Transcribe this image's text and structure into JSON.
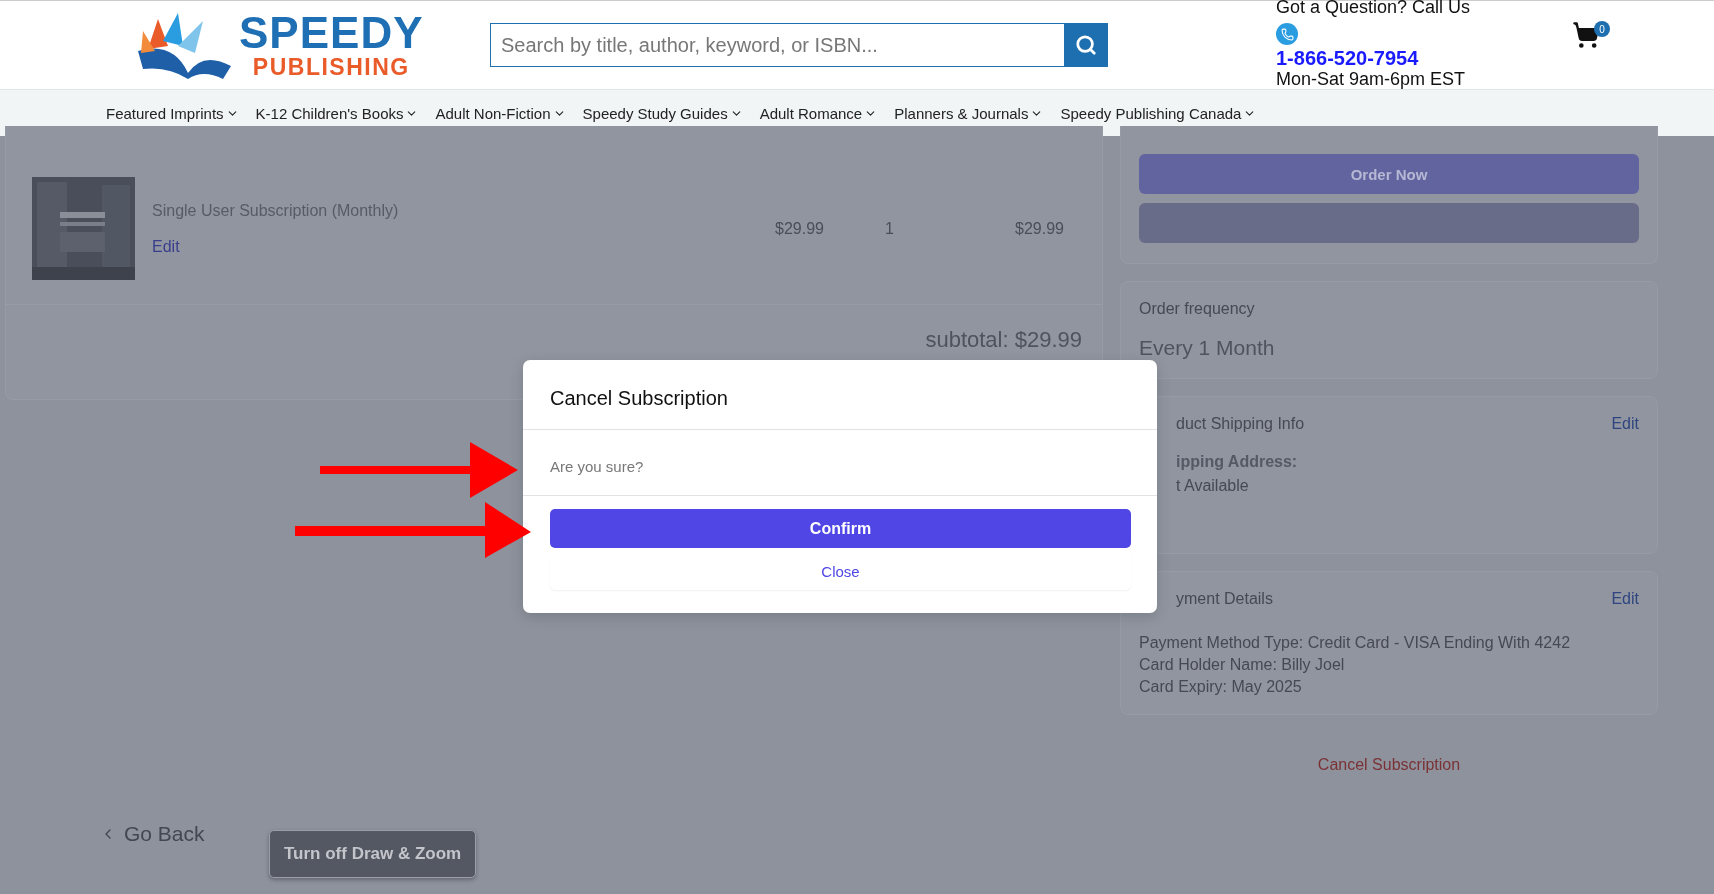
{
  "header": {
    "logo": {
      "line1": "SPEEDY",
      "line2": "PUBLISHING"
    },
    "search": {
      "placeholder": "Search by title, author, keyword, or ISBN..."
    },
    "contact": {
      "question": "Got a Question? Call Us",
      "phone": "1-866-520-7954",
      "hours": "Mon-Sat 9am-6pm EST"
    },
    "cart": {
      "count": "0"
    }
  },
  "nav": [
    "Featured Imprints",
    "K-12 Children's Books",
    "Adult Non-Fiction",
    "Speedy Study Guides",
    "Adult Romance",
    "Planners & Journals",
    "Speedy Publishing Canada"
  ],
  "cart_item": {
    "title": "Single User Subscription (Monthly)",
    "edit": "Edit",
    "price": "$29.99",
    "quantity": "1",
    "total": "$29.99"
  },
  "subtotal": "subtotal: $29.99",
  "actions": {
    "order_now": "Order Now"
  },
  "order_frequency": {
    "label": "Order frequency",
    "value": "Every 1 Month"
  },
  "shipping": {
    "title": "duct Shipping Info",
    "edit": "Edit",
    "address_label": "ipping Address:",
    "address": "t Available"
  },
  "payment": {
    "title": "yment Details",
    "edit": "Edit",
    "lines": [
      "Payment Method Type: Credit Card - VISA Ending With 4242",
      "Card Holder Name: Billy Joel",
      "Card Expiry: May 2025"
    ]
  },
  "cancel_link": "Cancel Subscription",
  "go_back": "Go Back",
  "tooltip": "Turn off Draw & Zoom",
  "modal": {
    "title": "Cancel Subscription",
    "message": "Are you sure?",
    "confirm": "Confirm",
    "close": "Close"
  }
}
